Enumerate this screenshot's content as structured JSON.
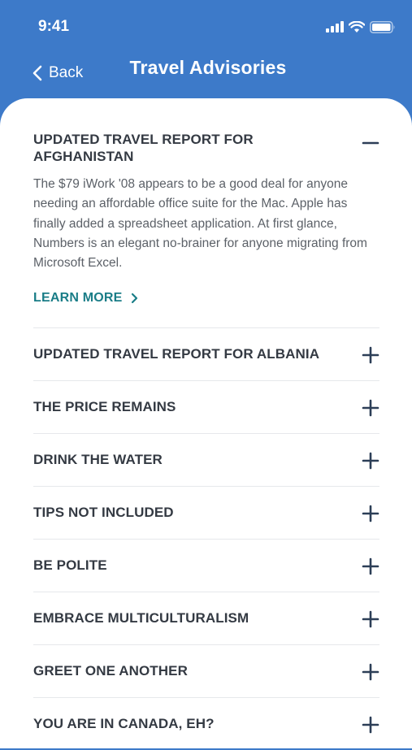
{
  "status": {
    "time": "9:41"
  },
  "nav": {
    "back_label": "Back",
    "title": "Travel Advisories"
  },
  "expanded": {
    "title": "UPDATED TRAVEL REPORT FOR AFGHANISTAN",
    "description": "The $79 iWork '08 appears to be a good deal for anyone needing an affordable office suite for the Mac. Apple has finally added a spreadsheet application. At first glance, Numbers is an elegant no-brainer for anyone migrating from Microsoft Excel.",
    "link_label": "LEARN MORE",
    "toggle_icon": "minus-icon"
  },
  "items": [
    {
      "title": "UPDATED TRAVEL REPORT FOR ALBANIA",
      "toggle_icon": "plus-icon"
    },
    {
      "title": "THE PRICE REMAINS",
      "toggle_icon": "plus-icon"
    },
    {
      "title": "DRINK THE WATER",
      "toggle_icon": "plus-icon"
    },
    {
      "title": "TIPS NOT INCLUDED",
      "toggle_icon": "plus-icon"
    },
    {
      "title": "BE POLITE",
      "toggle_icon": "plus-icon"
    },
    {
      "title": "EMBRACE MULTICULTURALISM",
      "toggle_icon": "plus-icon"
    },
    {
      "title": "GREET ONE ANOTHER",
      "toggle_icon": "plus-icon"
    },
    {
      "title": "YOU ARE IN CANADA, EH?",
      "toggle_icon": "plus-icon"
    }
  ],
  "colors": {
    "header_bg": "#3d7ac9",
    "title_text": "#343a43",
    "link": "#1a7d87",
    "icon": "#2c3e57"
  }
}
